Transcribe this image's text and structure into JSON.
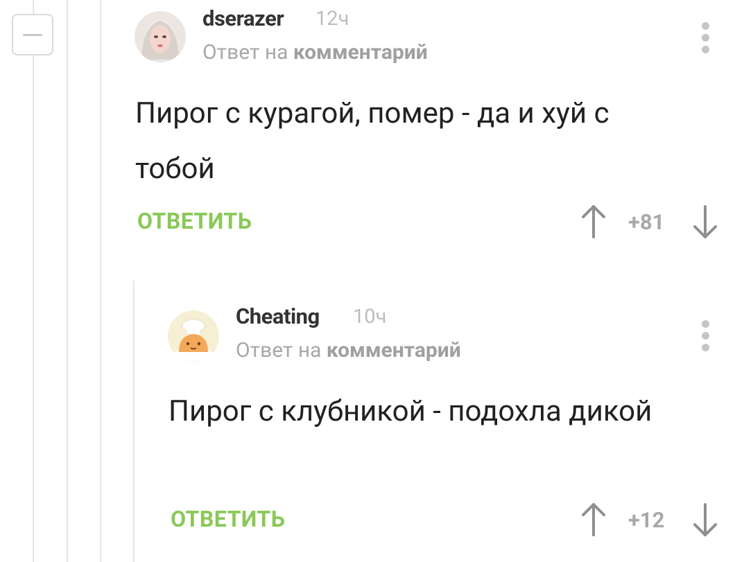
{
  "comments": [
    {
      "username": "dserazer",
      "time": "12ч",
      "reply_prefix": "Ответ на ",
      "reply_target": "комментарий",
      "text": "Пирог с курагой, помер - да и хуй с тобой",
      "reply_label": "ОТВЕТИТЬ",
      "rating": "+81"
    },
    {
      "username": "Cheating",
      "time": "10ч",
      "reply_prefix": "Ответ на ",
      "reply_target": "комментарий",
      "text": "Пирог с клубникой - подохла дикой",
      "reply_label": "ОТВЕТИТЬ",
      "rating": "+12"
    }
  ],
  "colors": {
    "accent_green": "#8ac858",
    "muted_gray": "#a8a8a8",
    "thread_line": "#e6e6e6"
  },
  "icons": {
    "collapse": "minus-icon",
    "vote_up": "arrow-up-icon",
    "vote_down": "arrow-down-icon",
    "menu": "more-vertical-icon"
  }
}
